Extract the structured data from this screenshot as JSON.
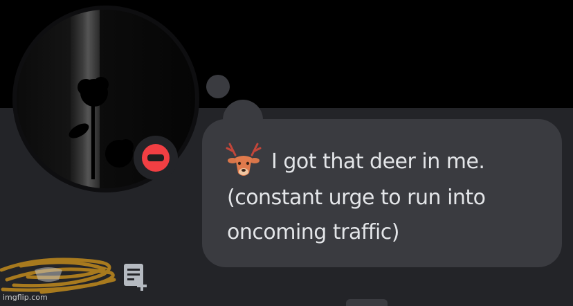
{
  "profile": {
    "custom_status": {
      "emoji": "deer-emoji",
      "line1": "I got that deer in me.",
      "line2": "(constant urge to run into",
      "line3": "oncoming traffic)"
    },
    "presence": "do-not-disturb"
  },
  "colors": {
    "banner": "#000000",
    "card_background": "#232428",
    "bubble": "#3a3b40",
    "text": "#e3e5e8",
    "dnd_red": "#f23f43"
  },
  "watermark": "imgflip.com"
}
